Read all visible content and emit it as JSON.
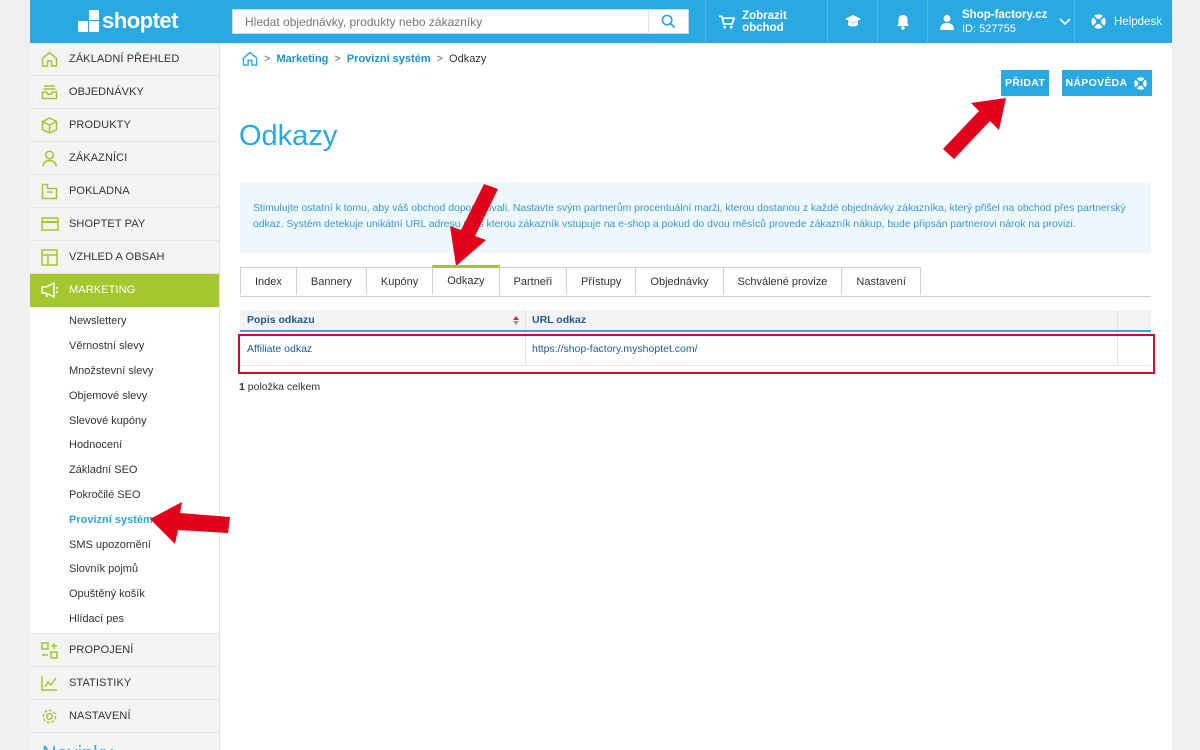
{
  "brand": {
    "logo_text": "shoptet"
  },
  "search": {
    "placeholder": "Hledat objednávky, produkty nebo zákazníky"
  },
  "topbar": {
    "shop_label": "Zobrazit obchod",
    "account_name": "Shop-factory.cz",
    "account_id": "ID: 527755",
    "help_label": "Helpdesk"
  },
  "sidebar": {
    "items_top": [
      {
        "label": "ZÁKLADNÍ PŘEHLED",
        "icon": "home-icon"
      },
      {
        "label": "OBJEDNÁVKY",
        "icon": "inbox-icon"
      },
      {
        "label": "PRODUKTY",
        "icon": "box-icon"
      },
      {
        "label": "ZÁKAZNÍCI",
        "icon": "user-icon"
      },
      {
        "label": "POKLADNA",
        "icon": "register-icon"
      },
      {
        "label": "SHOPTET PAY",
        "icon": "card-icon"
      },
      {
        "label": "VZHLED A OBSAH",
        "icon": "layout-icon"
      },
      {
        "label": "MARKETING",
        "icon": "megaphone-icon"
      }
    ],
    "sub_items": [
      "Newslettery",
      "Věrnostní slevy",
      "Množstevní slevy",
      "Objemové slevy",
      "Slevové kupóny",
      "Hodnocení",
      "Základní SEO",
      "Pokročilé SEO",
      "Provizní systém",
      "SMS upozornění",
      "Slovník pojmů",
      "Opuštěný košík",
      "Hlídací pes"
    ],
    "items_bottom": [
      {
        "label": "PROPOJENÍ",
        "icon": "connections-icon"
      },
      {
        "label": "STATISTIKY",
        "icon": "chart-icon"
      },
      {
        "label": "NASTAVENÍ",
        "icon": "gear-icon"
      }
    ],
    "tail_text": "Novinky"
  },
  "breadcrumb": {
    "link1": "Marketing",
    "link2": "Provizní systém",
    "current": "Odkazy",
    "sep": ">"
  },
  "buttons": {
    "add": "PŘIDAT",
    "help": "NÁPOVĚDA"
  },
  "page": {
    "title": "Odkazy",
    "info": "Stimulujte ostatní k tomu, aby váš obchod doporučovali. Nastavte svým partnerům procentuální marži, kterou dostanou z každé objednávky zákazníka, který přišel na obchod přes partnerský odkaz. Systém detekuje unikátní URL adresu přes kterou zákazník vstupuje na e-shop a pokud do dvou měsíců provede zákazník nákup, bude připsán partnerovi nárok na provizi."
  },
  "tabs": [
    "Index",
    "Bannery",
    "Kupóny",
    "Odkazy",
    "Partneři",
    "Přístupy",
    "Objednávky",
    "Schválené provize",
    "Nastavení"
  ],
  "active_tab": "Odkazy",
  "table": {
    "headers": [
      "Popis odkazu",
      "URL odkaz"
    ],
    "rows": [
      {
        "desc": "Affiliate odkaz",
        "url": "https://shop-factory.myshoptet.com/"
      }
    ]
  },
  "total": {
    "count": "1",
    "label": " položka celkem"
  },
  "colors": {
    "primary": "#29a9e1",
    "accent_green": "#a3c72d",
    "highlight_red": "#c8102e",
    "arrow_red": "#e3001b"
  }
}
